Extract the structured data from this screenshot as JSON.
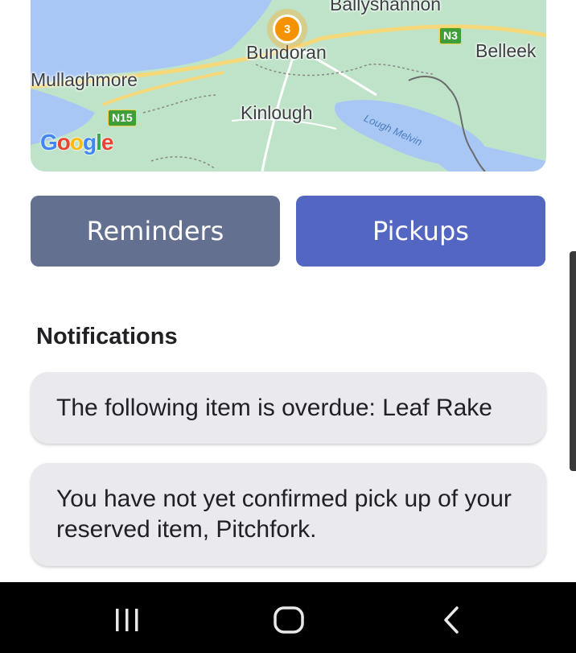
{
  "map": {
    "places": {
      "ballyshannon": "Ballyshannon",
      "bundoran": "Bundoran",
      "belleek": "Belleek",
      "mullaghmore": "Mullaghmore",
      "kinlough": "Kinlough",
      "lough_melvin": "Lough Melvin"
    },
    "roads": {
      "n3": "N3",
      "n15": "N15"
    },
    "cluster_count": "3",
    "attribution": "Google"
  },
  "buttons": {
    "reminders": "Reminders",
    "pickups": "Pickups"
  },
  "notifications": {
    "title": "Notifications",
    "items": [
      {
        "text": "The following item is overdue: Leaf Rake"
      },
      {
        "text": "You have not yet confirmed pick up of your reserved item, Pitchfork."
      }
    ]
  },
  "colors": {
    "reminders_button": "#637090",
    "pickups_button": "#5366c2",
    "notification_bg": "#e9e9ee",
    "cluster": "#f59200",
    "nav_bar": "#000000"
  },
  "navbar": {
    "recents_icon": "recents-icon",
    "home_icon": "home-icon",
    "back_icon": "back-icon"
  }
}
